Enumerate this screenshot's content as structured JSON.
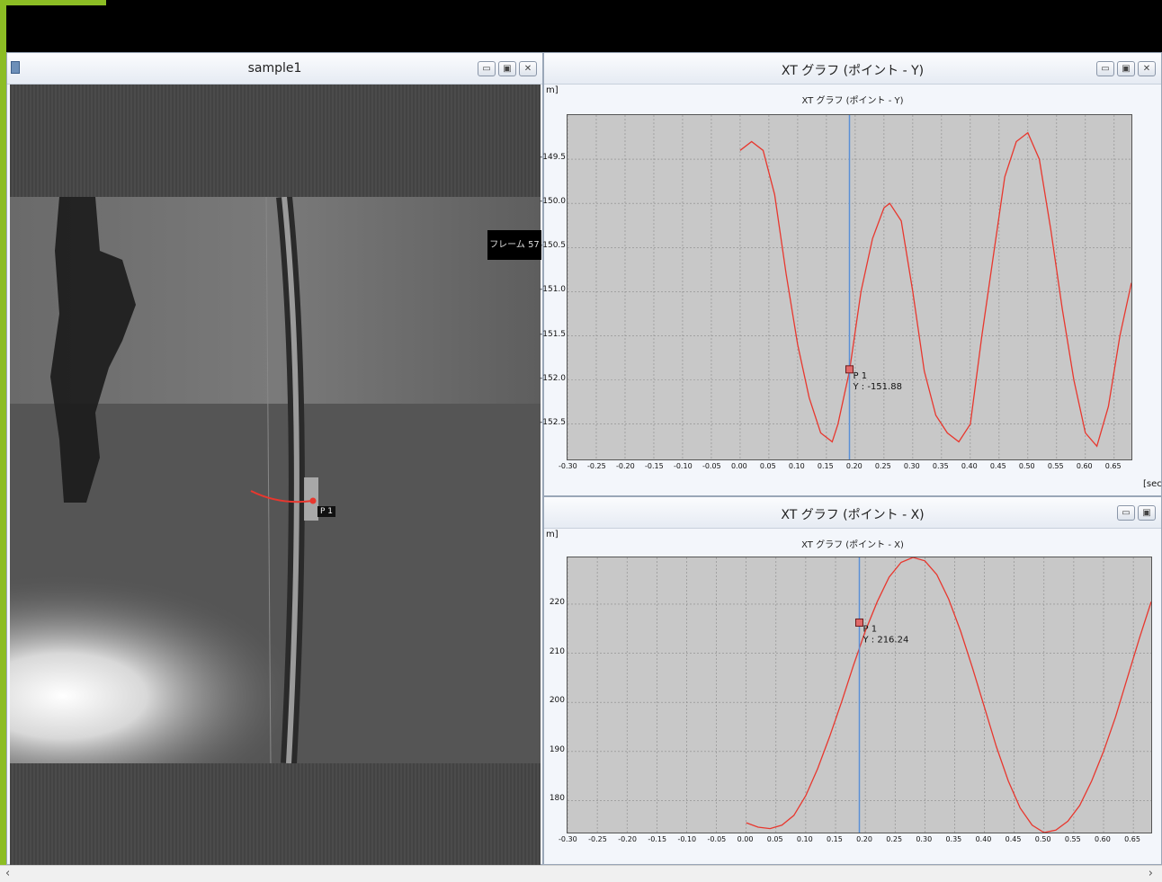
{
  "video_window": {
    "title": "sample1",
    "frame_label": "フレーム 57",
    "point_label": "P 1"
  },
  "graph_y": {
    "window_title": "XT グラフ (ポイント - Y)",
    "inner_title": "XT グラフ (ポイント - Y)",
    "unit_top": "m]",
    "unit_x": "[sec",
    "marker_label": "P 1",
    "marker_value": "Y : -151.88",
    "y_ticks": [
      "-149.5",
      "-150.0",
      "-150.5",
      "-151.0",
      "-151.5",
      "-152.0",
      "-152.5"
    ],
    "x_ticks": [
      "-0.30",
      "-0.25",
      "-0.20",
      "-0.15",
      "-0.10",
      "-0.05",
      "0.00",
      "0.05",
      "0.10",
      "0.15",
      "0.20",
      "0.25",
      "0.30",
      "0.35",
      "0.40",
      "0.45",
      "0.50",
      "0.55",
      "0.60",
      "0.65"
    ]
  },
  "graph_x": {
    "window_title": "XT グラフ (ポイント - X)",
    "inner_title": "XT グラフ (ポイント - X)",
    "unit_top": "m]",
    "marker_label": "P 1",
    "marker_value": "Y : 216.24",
    "y_ticks": [
      "220",
      "210",
      "200",
      "190",
      "180"
    ],
    "x_ticks": [
      "-0.30",
      "-0.25",
      "-0.20",
      "-0.15",
      "-0.10",
      "-0.05",
      "0.00",
      "0.05",
      "0.10",
      "0.15",
      "0.20",
      "0.25",
      "0.30",
      "0.35",
      "0.40",
      "0.45",
      "0.50",
      "0.55",
      "0.60",
      "0.65"
    ]
  },
  "colors": {
    "curve": "#e8372e",
    "cursor": "#5b8fd6",
    "plot_bg": "#c8c8c8",
    "accent_green": "#8cbd24"
  },
  "icons": {
    "minimize": "minimize-icon",
    "maximize": "maximize-icon",
    "close": "close-icon"
  },
  "chart_data": [
    {
      "type": "line",
      "title": "XT グラフ (ポイント - Y)",
      "xlim": [
        -0.3,
        0.68
      ],
      "ylim": [
        -152.9,
        -149.0
      ],
      "cursor_x": 0.19,
      "marker": {
        "x": 0.19,
        "y": -151.88
      },
      "x": [
        0.0,
        0.02,
        0.04,
        0.06,
        0.08,
        0.1,
        0.12,
        0.14,
        0.16,
        0.17,
        0.19,
        0.21,
        0.23,
        0.25,
        0.26,
        0.28,
        0.3,
        0.32,
        0.34,
        0.36,
        0.38,
        0.4,
        0.42,
        0.44,
        0.46,
        0.48,
        0.5,
        0.52,
        0.54,
        0.56,
        0.58,
        0.6,
        0.62,
        0.64,
        0.66,
        0.68
      ],
      "y": [
        -149.4,
        -149.3,
        -149.4,
        -149.9,
        -150.8,
        -151.6,
        -152.2,
        -152.6,
        -152.7,
        -152.5,
        -151.9,
        -151.0,
        -150.4,
        -150.05,
        -150.0,
        -150.2,
        -151.0,
        -151.9,
        -152.4,
        -152.6,
        -152.7,
        -152.5,
        -151.5,
        -150.6,
        -149.7,
        -149.3,
        -149.2,
        -149.5,
        -150.3,
        -151.2,
        -152.0,
        -152.6,
        -152.75,
        -152.3,
        -151.5,
        -150.9
      ]
    },
    {
      "type": "line",
      "title": "XT グラフ (ポイント - X)",
      "xlim": [
        -0.3,
        0.68
      ],
      "ylim": [
        173.5,
        229.5
      ],
      "cursor_x": 0.19,
      "marker": {
        "x": 0.19,
        "y": 216.24
      },
      "x": [
        0.0,
        0.02,
        0.04,
        0.06,
        0.08,
        0.1,
        0.12,
        0.14,
        0.16,
        0.18,
        0.2,
        0.22,
        0.24,
        0.26,
        0.28,
        0.3,
        0.32,
        0.34,
        0.36,
        0.38,
        0.4,
        0.42,
        0.44,
        0.46,
        0.48,
        0.5,
        0.52,
        0.54,
        0.56,
        0.58,
        0.6,
        0.62,
        0.64,
        0.66,
        0.68
      ],
      "y": [
        175.5,
        174.6,
        174.3,
        175.0,
        177.0,
        181.0,
        186.5,
        193.0,
        200.0,
        207.5,
        214.5,
        220.5,
        225.5,
        228.5,
        229.5,
        228.8,
        226.0,
        221.0,
        214.5,
        207.0,
        199.0,
        191.0,
        184.0,
        178.5,
        175.0,
        173.5,
        174.0,
        175.8,
        179.0,
        184.0,
        190.0,
        197.0,
        205.0,
        213.0,
        220.5
      ]
    }
  ]
}
